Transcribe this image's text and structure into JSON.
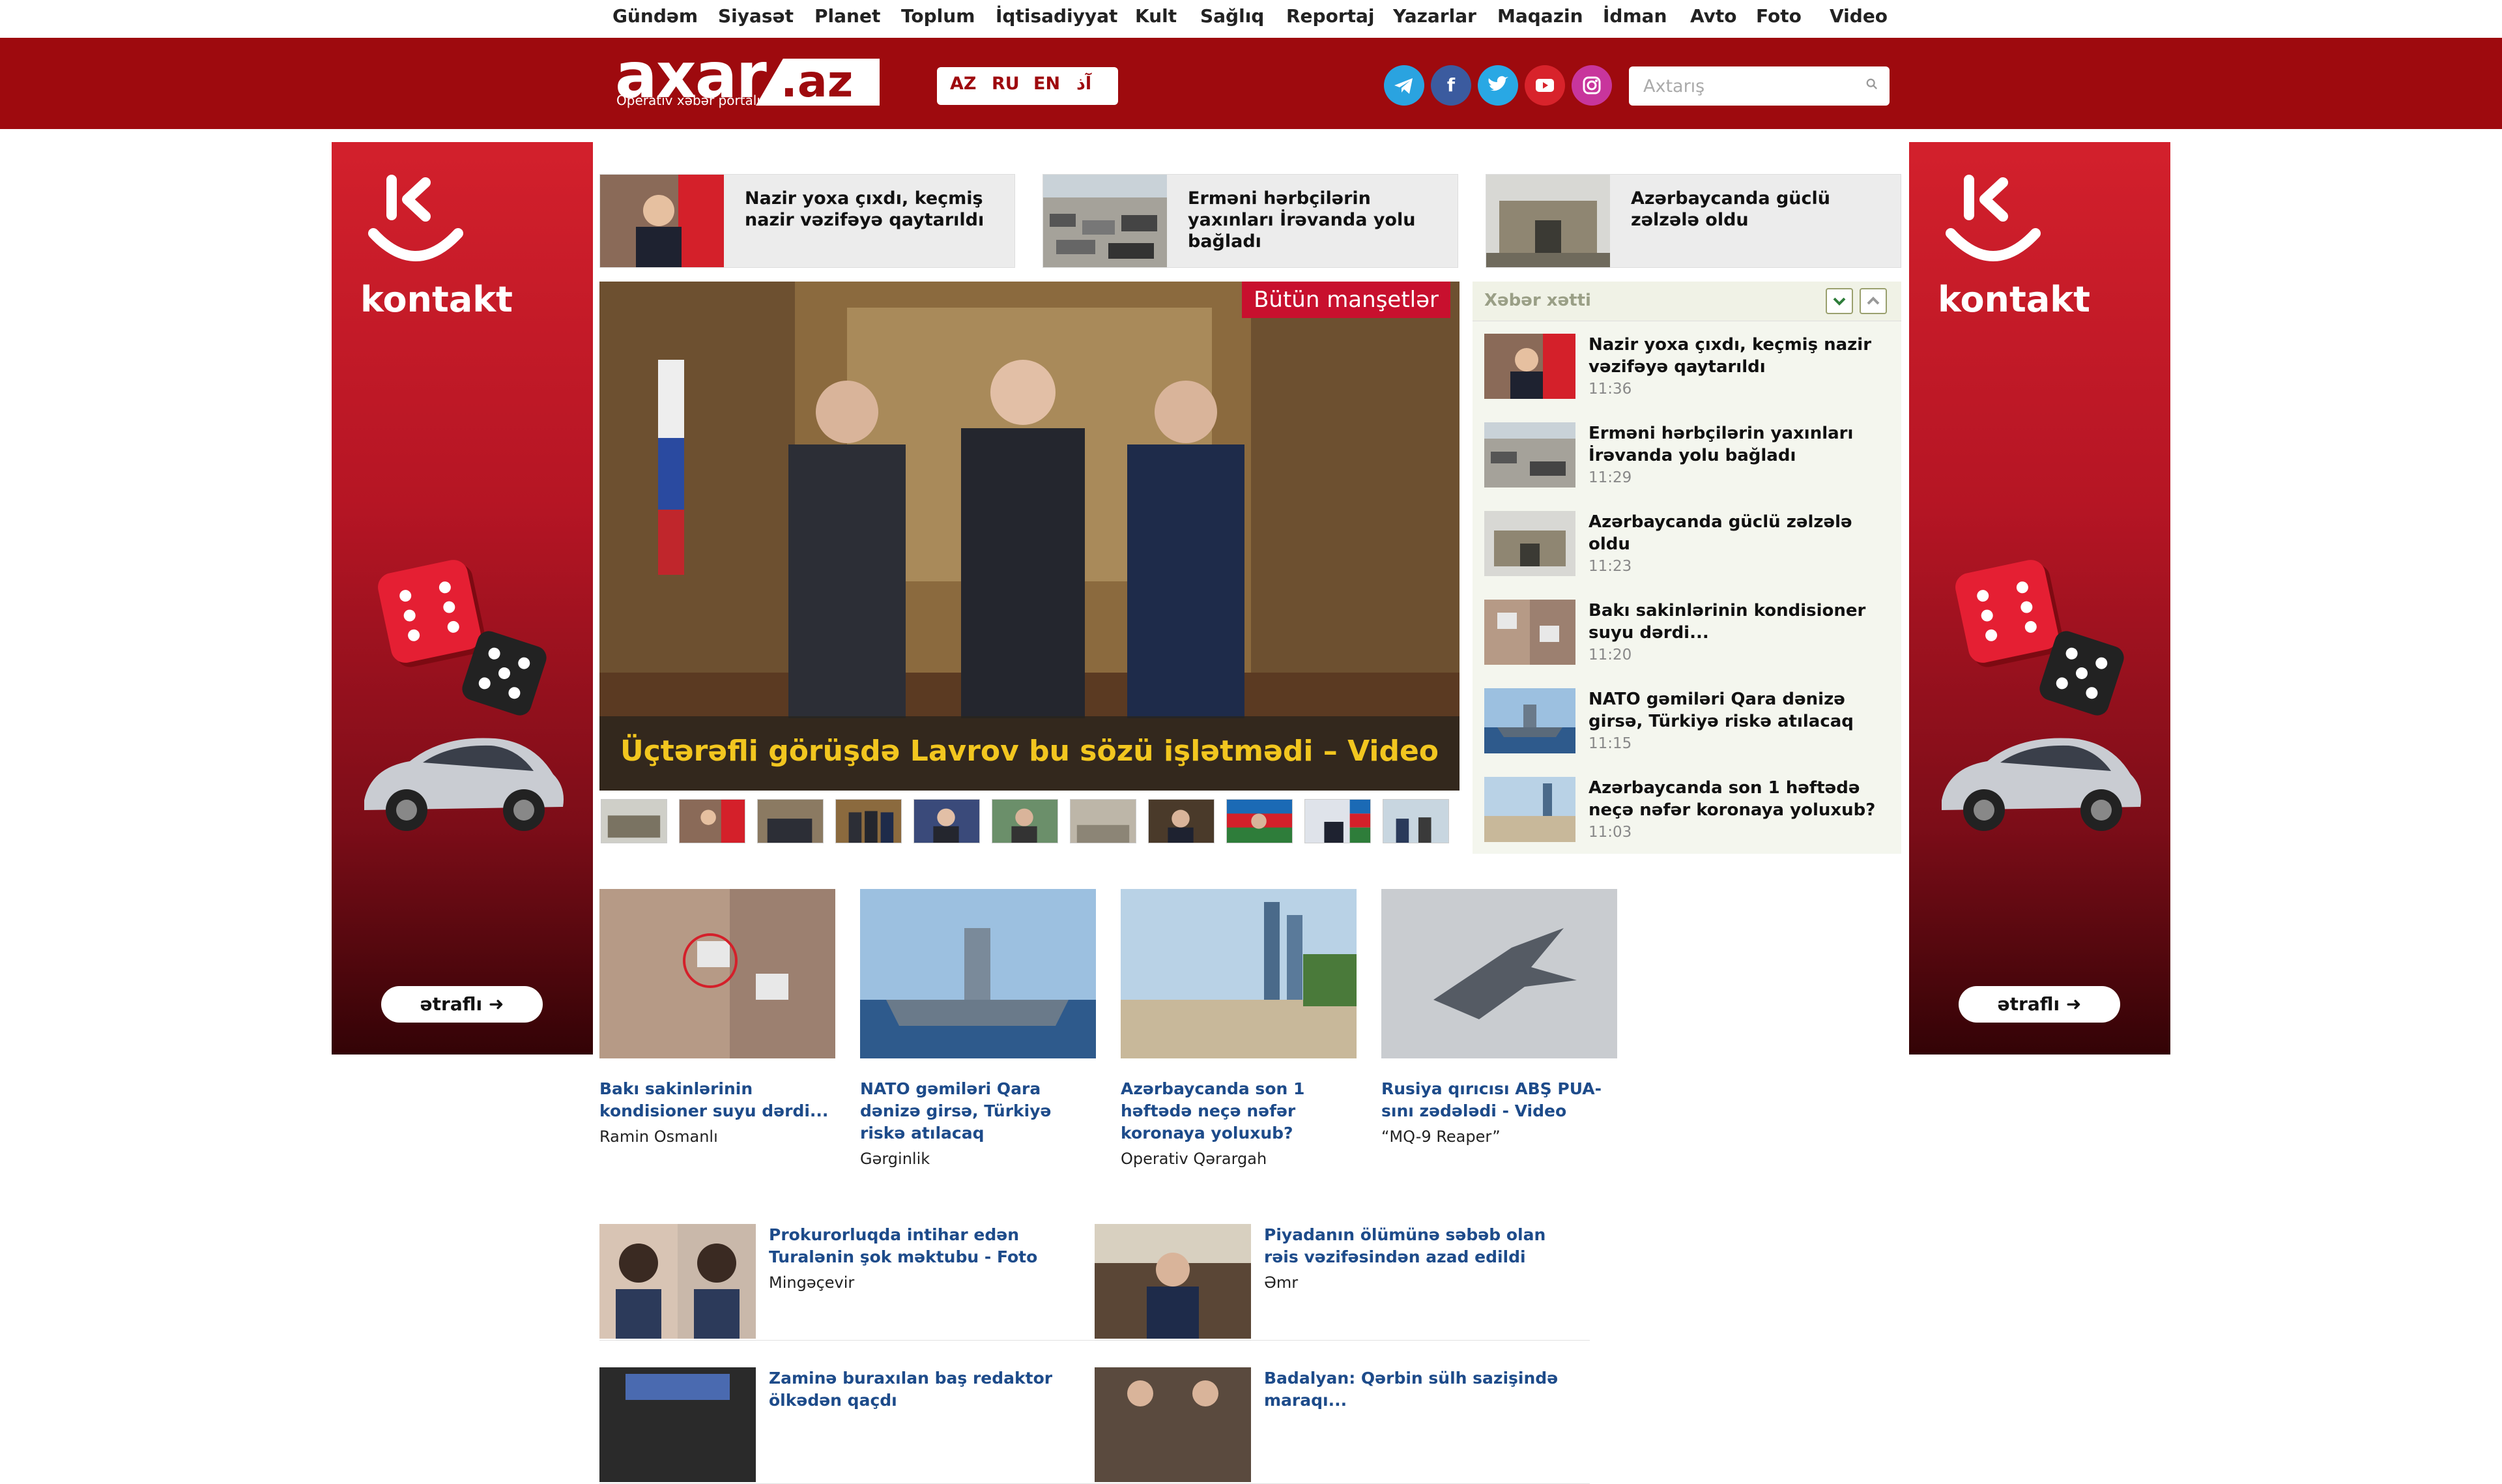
{
  "nav": {
    "items": [
      "Gündəm",
      "Siyasət",
      "Planet",
      "Toplum",
      "İqtisadiyyat",
      "Kult",
      "Sağlıq",
      "Reportaj",
      "Yazarlar",
      "Maqazin",
      "İdman",
      "Avto",
      "Foto",
      "Video"
    ]
  },
  "header": {
    "logo_main": "axar",
    "logo_suffix": ".az",
    "logo_tagline": "Operativ xəbər portalı",
    "languages": [
      "AZ",
      "RU",
      "EN",
      "آذ"
    ],
    "search_placeholder": "Axtarış",
    "social": [
      "telegram-icon",
      "facebook-icon",
      "twitter-icon",
      "youtube-icon",
      "instagram-icon"
    ]
  },
  "ads": {
    "brand": "kontakt",
    "button": "ətraflı ➜"
  },
  "top_cards": [
    {
      "title": "Nazir yoxa çıxdı, keçmiş nazir vəzifəyə qaytarıldı"
    },
    {
      "title": "Erməni hərbçilərin yaxınları İrəvanda yolu bağladı"
    },
    {
      "title": "Azərbaycanda güclü zəlzələ oldu"
    }
  ],
  "slider": {
    "all_link": "Bütün manşetlər",
    "caption": "Üçtərəfli görüşdə Lavrov bu sözü işlətmədi – Video"
  },
  "feed": {
    "title": "Xəbər xətti",
    "items": [
      {
        "title": "Nazir yoxa çıxdı, keçmiş nazir vəzifəyə qaytarıldı",
        "time": "11:36"
      },
      {
        "title": "Erməni hərbçilərin yaxınları İrəvanda yolu bağladı",
        "time": "11:29"
      },
      {
        "title": "Azərbaycanda güclü zəlzələ oldu",
        "time": "11:23"
      },
      {
        "title": "Bakı sakinlərinin kondisioner suyu dərdi...",
        "time": "11:20"
      },
      {
        "title": "NATO gəmiləri Qara dənizə girsə, Türkiyə riskə atılacaq",
        "time": "11:15"
      },
      {
        "title": "Azərbaycanda son 1 həftədə neçə nəfər koronaya yoluxub?",
        "time": "11:03"
      }
    ]
  },
  "grid": [
    {
      "title": "Bakı sakinlərinin kondisioner suyu dərdi...",
      "sub": "Ramin Osmanlı"
    },
    {
      "title": "NATO gəmiləri Qara dənizə girsə, Türkiyə riskə atılacaq",
      "sub": "Gərginlik"
    },
    {
      "title": "Azərbaycanda son 1 həftədə neçə nəfər koronaya yoluxub?",
      "sub": "Operativ Qərargah"
    },
    {
      "title": "Rusiya qırıcısı ABŞ PUA-sını zədələdi - Video",
      "sub": "“MQ-9 Reaper”"
    }
  ],
  "list": [
    {
      "title": "Prokurorluqda intihar edən Turalənin şok məktubu - Foto",
      "sub": "Mingəçevir"
    },
    {
      "title": "Piyadanın ölümünə səbəb olan rəis vəzifəsindən azad edildi",
      "sub": "Əmr"
    },
    {
      "title": "Zaminə buraxılan baş redaktor ölkədən qaçdı",
      "sub": ""
    },
    {
      "title": "Badalyan: Qərbin sülh sazişində maraqı...",
      "sub": ""
    }
  ],
  "colors": {
    "brand_red": "#9e0a0e",
    "caption_yellow": "#f2c61f",
    "link_blue": "#1d4b8a"
  }
}
